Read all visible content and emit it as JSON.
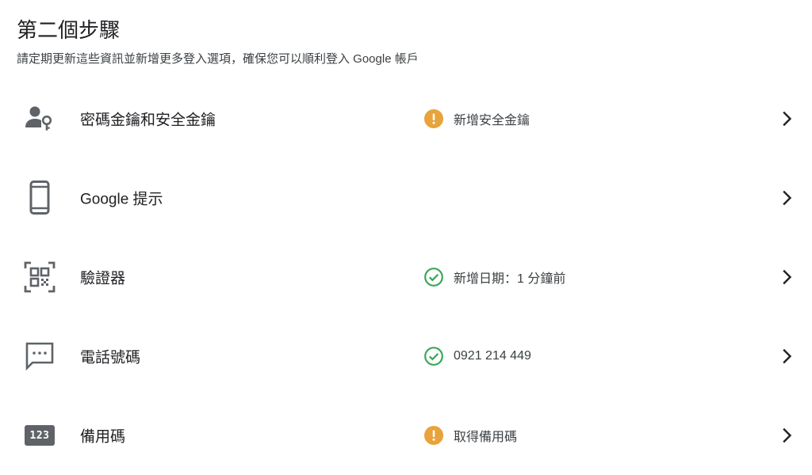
{
  "header": {
    "title": "第二個步驟",
    "subtitle": "請定期更新這些資訊並新增更多登入選項，確保您可以順利登入 Google 帳戶"
  },
  "colors": {
    "warning": "#e8a33a",
    "success": "#3aa757",
    "icon": "#5f6368",
    "text": "#202124"
  },
  "rows": [
    {
      "label": "密碼金鑰和安全金鑰",
      "icon": "passkey-person-key-icon",
      "status_icon": "warning-icon",
      "status": "新增安全金鑰"
    },
    {
      "label": "Google 提示",
      "icon": "phone-icon",
      "status_icon": "",
      "status": ""
    },
    {
      "label": "驗證器",
      "icon": "qr-code-scanner-icon",
      "status_icon": "check-circle-icon",
      "status": "新增日期：1 分鐘前"
    },
    {
      "label": "電話號碼",
      "icon": "message-dots-icon",
      "status_icon": "check-circle-icon",
      "status": "0921 214 449"
    },
    {
      "label": "備用碼",
      "icon": "backup-codes-123-icon",
      "icon_text": "123",
      "status_icon": "warning-icon",
      "status": "取得備用碼"
    }
  ]
}
